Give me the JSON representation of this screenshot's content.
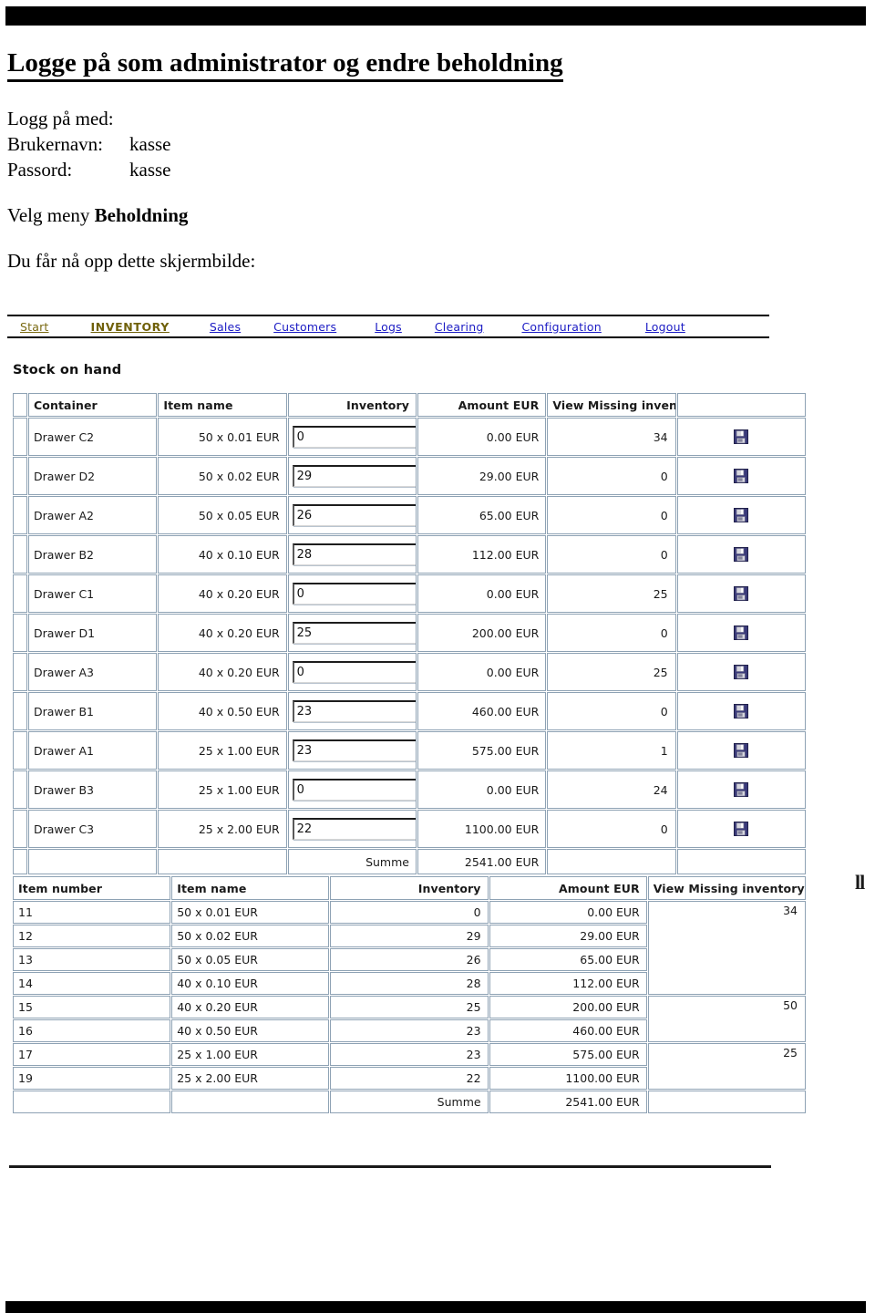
{
  "document": {
    "title": "Logge på som administrator og endre beholdning",
    "login_intro": "Logg på med:",
    "username_label": "Brukernavn:",
    "username_value": "kasse",
    "password_label": "Passord:",
    "password_value": "kasse",
    "menu_instruction_prefix": "Velg meny ",
    "menu_instruction_bold": "Beholdning",
    "screenshot_intro": "Du får nå opp dette skjermbilde:",
    "stray_mark": "ll"
  },
  "app": {
    "nav": [
      {
        "label": "Start",
        "style": "olive",
        "icon": "link-icon"
      },
      {
        "label": "INVENTORY",
        "style": "current",
        "icon": "link-icon"
      },
      {
        "label": "Sales",
        "style": "blue",
        "icon": "link-icon"
      },
      {
        "label": "Customers",
        "style": "blue",
        "icon": "link-icon"
      },
      {
        "label": "Logs",
        "style": "blue",
        "icon": "link-icon"
      },
      {
        "label": "Clearing",
        "style": "blue",
        "icon": "link-icon"
      },
      {
        "label": "Configuration",
        "style": "blue",
        "icon": "link-icon"
      },
      {
        "label": "Logout",
        "style": "blue",
        "icon": "link-icon"
      }
    ],
    "section_heading": "Stock on hand",
    "save_icon_name": "floppy-save-icon",
    "colors": {
      "link_blue": "#1b1bc4",
      "link_olive": "#7a6a12",
      "table_border": "#8ea2b4",
      "floppy_body": "#3a3a7a",
      "floppy_shutter": "#d6d6de"
    },
    "stock_table": {
      "headers": [
        "Container",
        "Item name",
        "Inventory",
        "Amount EUR",
        "View Missing inventory",
        ""
      ],
      "rows": [
        {
          "container": "Drawer C2",
          "item": "50 x 0.01 EUR",
          "inventory": "0",
          "amount": "0.00 EUR",
          "missing": "34"
        },
        {
          "container": "Drawer D2",
          "item": "50 x 0.02 EUR",
          "inventory": "29",
          "amount": "29.00 EUR",
          "missing": "0"
        },
        {
          "container": "Drawer A2",
          "item": "50 x 0.05 EUR",
          "inventory": "26",
          "amount": "65.00 EUR",
          "missing": "0"
        },
        {
          "container": "Drawer B2",
          "item": "40 x 0.10 EUR",
          "inventory": "28",
          "amount": "112.00 EUR",
          "missing": "0"
        },
        {
          "container": "Drawer C1",
          "item": "40 x 0.20 EUR",
          "inventory": "0",
          "amount": "0.00 EUR",
          "missing": "25"
        },
        {
          "container": "Drawer D1",
          "item": "40 x 0.20 EUR",
          "inventory": "25",
          "amount": "200.00 EUR",
          "missing": "0"
        },
        {
          "container": "Drawer A3",
          "item": "40 x 0.20 EUR",
          "inventory": "0",
          "amount": "0.00 EUR",
          "missing": "25"
        },
        {
          "container": "Drawer B1",
          "item": "40 x 0.50 EUR",
          "inventory": "23",
          "amount": "460.00 EUR",
          "missing": "0"
        },
        {
          "container": "Drawer A1",
          "item": "25 x 1.00 EUR",
          "inventory": "23",
          "amount": "575.00 EUR",
          "missing": "1"
        },
        {
          "container": "Drawer B3",
          "item": "25 x 1.00 EUR",
          "inventory": "0",
          "amount": "0.00 EUR",
          "missing": "24"
        },
        {
          "container": "Drawer C3",
          "item": "25 x 2.00 EUR",
          "inventory": "22",
          "amount": "1100.00 EUR",
          "missing": "0"
        }
      ],
      "sum_label": "Summe",
      "sum_amount": "2541.00 EUR"
    },
    "summary_table": {
      "headers": [
        "Item number",
        "Item name",
        "Inventory",
        "Amount EUR",
        "View Missing inventory"
      ],
      "rows": [
        {
          "number": "11",
          "item": "50 x 0.01 EUR",
          "inventory": "0",
          "amount": "0.00 EUR",
          "missing": "34",
          "missing_span": 4
        },
        {
          "number": "12",
          "item": "50 x 0.02 EUR",
          "inventory": "29",
          "amount": "29.00 EUR",
          "missing": "",
          "missing_span": 0
        },
        {
          "number": "13",
          "item": "50 x 0.05 EUR",
          "inventory": "26",
          "amount": "65.00 EUR",
          "missing": "",
          "missing_span": 0
        },
        {
          "number": "14",
          "item": "40 x 0.10 EUR",
          "inventory": "28",
          "amount": "112.00 EUR",
          "missing": "",
          "missing_span": 0
        },
        {
          "number": "15",
          "item": "40 x 0.20 EUR",
          "inventory": "25",
          "amount": "200.00 EUR",
          "missing": "50",
          "missing_span": 2
        },
        {
          "number": "16",
          "item": "40 x 0.50 EUR",
          "inventory": "23",
          "amount": "460.00 EUR",
          "missing": "",
          "missing_span": 0
        },
        {
          "number": "17",
          "item": "25 x 1.00 EUR",
          "inventory": "23",
          "amount": "575.00 EUR",
          "missing": "25",
          "missing_span": 2
        },
        {
          "number": "19",
          "item": "25 x 2.00 EUR",
          "inventory": "22",
          "amount": "1100.00 EUR",
          "missing": "",
          "missing_span": 0
        }
      ],
      "sum_label": "Summe",
      "sum_amount": "2541.00 EUR"
    }
  }
}
